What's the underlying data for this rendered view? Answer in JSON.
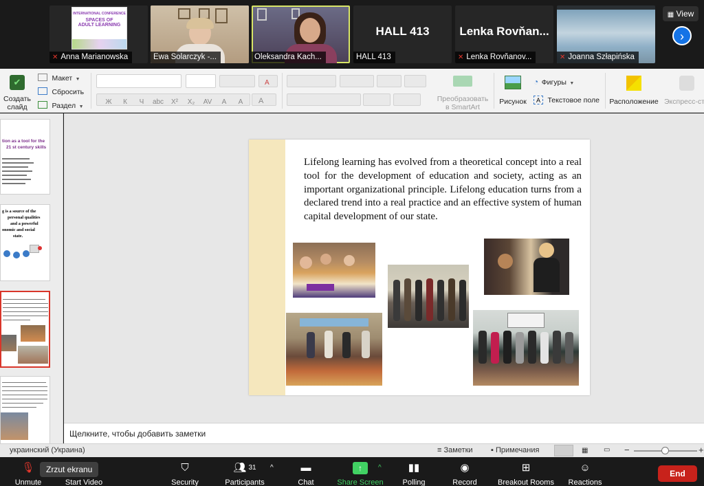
{
  "participants_strip": {
    "tiles": [
      {
        "name": "Anna Marianowska",
        "muted": true
      },
      {
        "name": "Ewa Solarczyk -...",
        "muted": false
      },
      {
        "name": "Oleksandra Kach...",
        "muted": false
      },
      {
        "name": "HALL 413",
        "muted": false,
        "big_label": "HALL 413"
      },
      {
        "name": "Lenka Rovňanov...",
        "muted": true,
        "big_label": "Lenka Rovňan..."
      },
      {
        "name": "Joanna Szłapińska",
        "muted": true
      }
    ],
    "poster_lines": [
      "INTERNATIONAL CONFERENCE",
      "SPACES OF",
      "ADULT LEARNING"
    ],
    "view_label": "View",
    "next_icon": "chevron-right-icon"
  },
  "ribbon": {
    "new_slide": [
      "Создать",
      "слайд"
    ],
    "layout": "Макет",
    "reset": "Сбросить",
    "section": "Раздел",
    "format_buttons": [
      "Ж",
      "К",
      "Ч",
      "abc",
      "X²",
      "X₂",
      "AV",
      "A",
      "A"
    ],
    "smartart": [
      "Преобразовать",
      "в SmartArt"
    ],
    "picture": "Рисунок",
    "shapes": "Фигуры",
    "textbox": "Текстовое поле",
    "arrange": "Расположение",
    "quick_styles": "Экспресс-сти"
  },
  "thumbnails": {
    "slide1_title": [
      "tion as a tool for the",
      "21 st century skills"
    ],
    "slide2_text": [
      "g is a source of the",
      "personal qualities",
      "and a powerful",
      "onomic and social",
      "state."
    ]
  },
  "slide": {
    "paragraph": "Lifelong learning has evolved from a theoretical concept into a real tool for the development of education and society, acting as an important organizational principle. Lifelong education turns from a declared trend into a real practice and an effective system of human capital development of our state."
  },
  "notes_placeholder": "Щелкните, чтобы добавить заметки",
  "status_bar": {
    "language": "украинский (Украина)",
    "notes": "Заметки",
    "comments": "Примечания",
    "zoom_percent": 55
  },
  "toolbar": {
    "tooltip": "Zrzut ekranu",
    "participants_count": "31",
    "items": [
      {
        "label": "Unmute",
        "icon": "microphone-muted-icon"
      },
      {
        "label": "Start Video",
        "icon": "video-icon"
      },
      {
        "label": "Security",
        "icon": "shield-icon"
      },
      {
        "label": "Participants",
        "icon": "people-icon"
      },
      {
        "label": "Chat",
        "icon": "chat-icon"
      },
      {
        "label": "Share Screen",
        "icon": "share-screen-icon"
      },
      {
        "label": "Polling",
        "icon": "bar-chart-icon"
      },
      {
        "label": "Record",
        "icon": "record-icon"
      },
      {
        "label": "Breakout Rooms",
        "icon": "breakout-rooms-icon"
      },
      {
        "label": "Reactions",
        "icon": "emoji-icon"
      }
    ],
    "end_label": "End"
  }
}
